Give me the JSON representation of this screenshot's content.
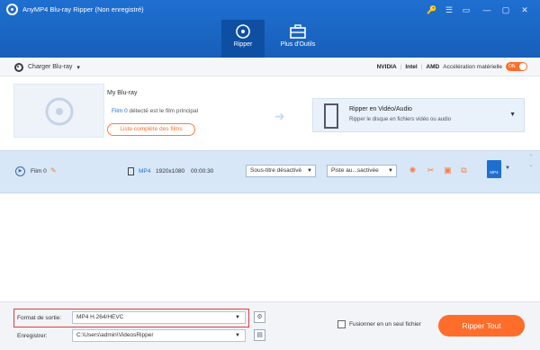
{
  "window": {
    "title": "AnyMP4 Blu-ray Ripper (Non enregistré)",
    "controls": [
      "🔑",
      "☰",
      "▭",
      "—",
      "▢",
      "✕"
    ]
  },
  "tabs": [
    {
      "label": "Ripper",
      "active": true
    },
    {
      "label": "Plus d'Outils",
      "active": false
    }
  ],
  "toolbar": {
    "load_label": "Charger Blu-ray",
    "hw": {
      "nvidia": "NVIDIA",
      "intel": "Intel",
      "amd": "AMD",
      "label": "Accélération matérielle",
      "toggle": "ON"
    }
  },
  "source": {
    "title": "My Blu-ray",
    "film_link": "Film 0",
    "detected_text": " détecté est le film principal",
    "list_button": "Liste complète des films",
    "rip_mode_title": "Ripper en Vidéo/Audio",
    "rip_mode_sub": "Ripper le disque en fichiers vidéo ou audio"
  },
  "film": {
    "name": "Film 0",
    "format": "MP4",
    "resolution": "1920x1080",
    "duration": "00:00:30",
    "subtitle": "Sous-titre désactivé",
    "audio": "Piste au...sactivée",
    "badge": "MP4"
  },
  "bottom": {
    "format_label": "Format de sortie:",
    "format_value": "MP4 H.264/HEVC",
    "save_label": "Enregistrer:",
    "save_path": "C:\\Users\\admin\\VideosRipper",
    "merge_label": "Fusionner en un seul fichier",
    "rip_all": "Ripper Tout"
  },
  "colors": {
    "brand": "#1f6fd1",
    "accent": "#ff6d2a",
    "highlight": "#e23c3c"
  }
}
